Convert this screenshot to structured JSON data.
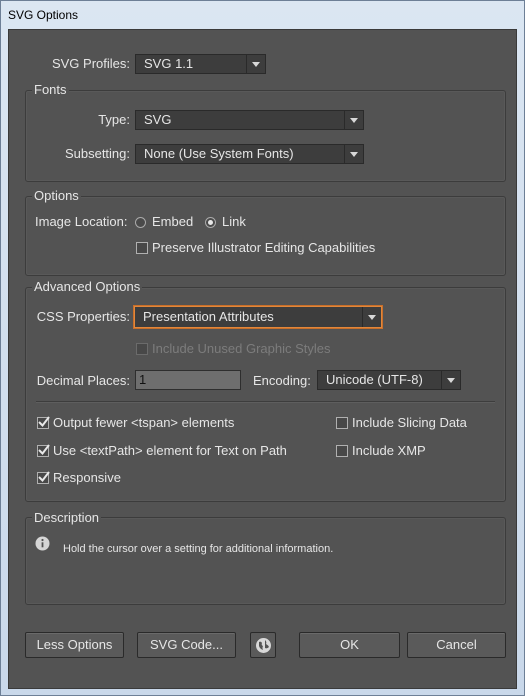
{
  "window": {
    "title": "SVG Options"
  },
  "profiles": {
    "label": "SVG Profiles:",
    "value": "SVG 1.1"
  },
  "fonts": {
    "title": "Fonts",
    "type_label": "Type:",
    "type_value": "SVG",
    "subsetting_label": "Subsetting:",
    "subsetting_value": "None (Use System Fonts)"
  },
  "options": {
    "title": "Options",
    "image_location_label": "Image Location:",
    "embed_label": "Embed",
    "link_label": "Link",
    "image_location_selected": "Link",
    "preserve_label": "Preserve Illustrator Editing Capabilities",
    "preserve_checked": false
  },
  "advanced": {
    "title": "Advanced Options",
    "css_label": "CSS Properties:",
    "css_value": "Presentation Attributes",
    "unused_styles_label": "Include Unused Graphic Styles",
    "decimal_label": "Decimal Places:",
    "decimal_value": "1",
    "encoding_label": "Encoding:",
    "encoding_value": "Unicode (UTF-8)",
    "checkboxes": {
      "fewer_tspan": {
        "label": "Output fewer <tspan> elements",
        "checked": true
      },
      "textpath": {
        "label": "Use <textPath> element for Text on Path",
        "checked": true
      },
      "responsive": {
        "label": "Responsive",
        "checked": true
      },
      "slicing": {
        "label": "Include Slicing Data",
        "checked": false
      },
      "xmp": {
        "label": "Include XMP",
        "checked": false
      }
    }
  },
  "description": {
    "title": "Description",
    "text": "Hold the cursor over a setting for additional information."
  },
  "buttons": {
    "less_options": "Less Options",
    "svg_code": "SVG Code...",
    "ok": "OK",
    "cancel": "Cancel"
  },
  "icons": [
    "info-icon",
    "globe-icon",
    "check-icon",
    "dropdown-arrow-icon"
  ]
}
